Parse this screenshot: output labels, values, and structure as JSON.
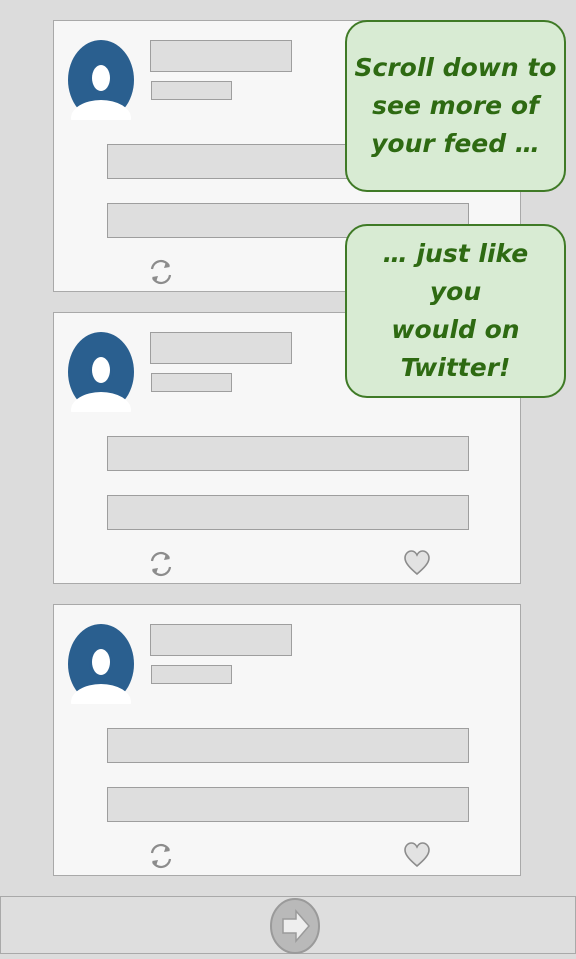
{
  "feed": {
    "tweets": [
      {
        "id": "tweet-1",
        "actions": {
          "retweet_icon": "retweet-icon",
          "like_icon": "heart-icon"
        }
      },
      {
        "id": "tweet-2",
        "actions": {
          "retweet_icon": "retweet-icon",
          "like_icon": "heart-icon"
        }
      },
      {
        "id": "tweet-3",
        "actions": {
          "retweet_icon": "retweet-icon",
          "like_icon": "heart-icon"
        }
      }
    ]
  },
  "callouts": {
    "first": "Scroll down to\nsee more of\nyour feed …",
    "second": "… just like you\nwould on\nTwitter!"
  },
  "bottom_bar": {
    "next_icon": "right-arrow-icon"
  },
  "colors": {
    "avatar": "#2a5f8f",
    "callout_fill": "#d8ebd3",
    "callout_border": "#3f7a26",
    "callout_text": "#2e6a12",
    "card_bg": "#f7f7f7",
    "page_bg": "#dcdcdc"
  }
}
